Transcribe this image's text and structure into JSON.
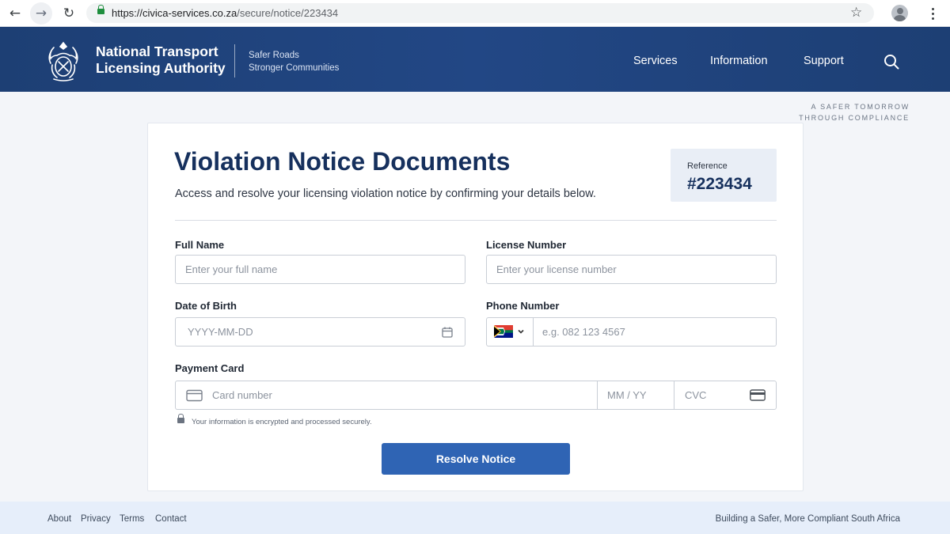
{
  "browser": {
    "url_domain": "https://civica-services.co.za",
    "url_path": "/secure/notice/223434"
  },
  "header": {
    "brand_line1": "National Transport",
    "brand_line2": "Licensing Authority",
    "tagline_line1": "Safer Roads",
    "tagline_line2": "Stronger Communities",
    "nav": [
      "Services",
      "Information",
      "Support"
    ]
  },
  "corner_tagline": {
    "line1": "A SAFER TOMORROW",
    "line2": "THROUGH COMPLIANCE"
  },
  "card": {
    "title": "Violation Notice Documents",
    "subtitle": "Access and resolve your licensing violation notice by confirming your details below.",
    "reference_label": "Reference",
    "reference_value": "#223434"
  },
  "form": {
    "full_name": {
      "label": "Full Name",
      "placeholder": "Enter your full name"
    },
    "license": {
      "label": "License Number",
      "placeholder": "Enter your license number"
    },
    "dob": {
      "label": "Date of Birth",
      "placeholder": "YYYY-MM-DD"
    },
    "phone": {
      "label": "Phone Number",
      "placeholder": "e.g. 082 123 4567"
    },
    "payment": {
      "label": "Payment Card",
      "card_placeholder": "Card number",
      "expiry_placeholder": "MM / YY",
      "cvc_placeholder": "CVC"
    },
    "secure_note": "Your information is encrypted and processed securely.",
    "submit_label": "Resolve Notice"
  },
  "footer": {
    "links": [
      "About",
      "Privacy",
      "Terms",
      "Contact"
    ],
    "tagline": "Building a Safer, More Compliant South Africa"
  },
  "colors": {
    "header_bg": "#1d3f74",
    "accent_button": "#2f64b4",
    "title_text": "#16305d",
    "footer_bg": "#e6eefa"
  },
  "icons": [
    "back-arrow-icon",
    "forward-arrow-icon",
    "reload-icon",
    "lock-icon",
    "star-icon",
    "profile-icon",
    "kebab-menu-icon",
    "crest-icon",
    "search-icon",
    "calendar-icon",
    "south-africa-flag-icon",
    "chevron-down-icon",
    "credit-card-icon",
    "cvc-card-icon",
    "secure-lock-icon"
  ]
}
